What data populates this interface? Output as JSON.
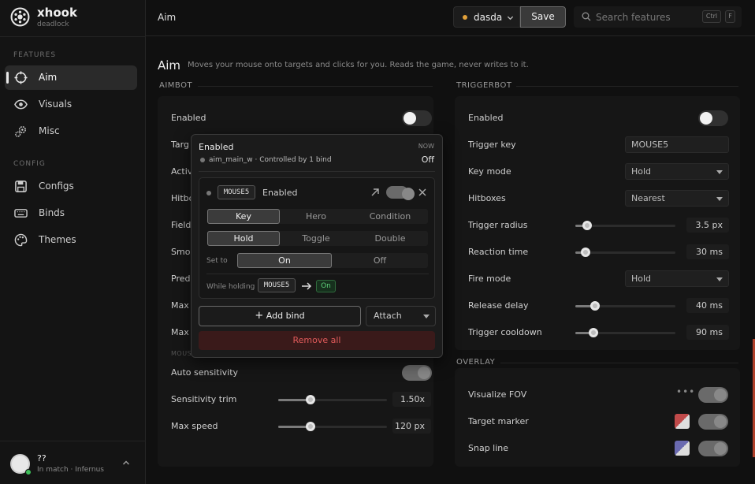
{
  "brand": {
    "name": "xhook",
    "subtitle": "deadlock"
  },
  "sidebar": {
    "features_label": "FEATURES",
    "config_label": "CONFIG",
    "items": [
      {
        "label": "Aim",
        "icon": "crosshair-icon",
        "active": true
      },
      {
        "label": "Visuals",
        "icon": "eye-icon"
      },
      {
        "label": "Misc",
        "icon": "gears-icon"
      },
      {
        "label": "Configs",
        "icon": "save-icon"
      },
      {
        "label": "Binds",
        "icon": "keyboard-icon"
      },
      {
        "label": "Themes",
        "icon": "palette-icon"
      }
    ]
  },
  "user": {
    "name": "??",
    "status": "In match · Infernus"
  },
  "topbar": {
    "breadcrumb": "Aim",
    "profile": "dasda",
    "save": "Save",
    "search_placeholder": "Search features",
    "kbd_ctrl": "Ctrl",
    "kbd_f": "F"
  },
  "page": {
    "title": "Aim",
    "description": "Moves your mouse onto targets and clicks for you. Reads the game, never writes to it."
  },
  "aimbot": {
    "header": "AIMBOT",
    "enabled_label": "Enabled",
    "hidden_labels": [
      "Targ",
      "Activ",
      "Hitbo",
      "Field",
      "Smo",
      "Pred",
      "Max",
      "Max"
    ],
    "mouse_header": "MOUS",
    "auto_sensitivity": "Auto sensitivity",
    "sensitivity_trim": {
      "label": "Sensitivity trim",
      "value": "1.50x",
      "fraction": 0.3
    },
    "max_speed": {
      "label": "Max speed",
      "value": "120 px",
      "fraction": 0.3
    }
  },
  "triggerbot": {
    "header": "TRIGGERBOT",
    "enabled_label": "Enabled",
    "trigger_key": {
      "label": "Trigger key",
      "value": "MOUSE5"
    },
    "key_mode": {
      "label": "Key mode",
      "value": "Hold"
    },
    "hitboxes": {
      "label": "Hitboxes",
      "value": "Nearest"
    },
    "trigger_radius": {
      "label": "Trigger radius",
      "value": "3.5 px",
      "fraction": 0.12
    },
    "reaction_time": {
      "label": "Reaction time",
      "value": "30 ms",
      "fraction": 0.1
    },
    "fire_mode": {
      "label": "Fire mode",
      "value": "Hold"
    },
    "release_delay": {
      "label": "Release delay",
      "value": "40 ms",
      "fraction": 0.2
    },
    "trigger_cooldown": {
      "label": "Trigger cooldown",
      "value": "90 ms",
      "fraction": 0.18
    }
  },
  "overlay": {
    "header": "OVERLAY",
    "visualize_fov": "Visualize FOV",
    "target_marker": "Target marker",
    "snap_line": "Snap line",
    "marker_color": "#c04a4a",
    "snap_color": "#6a6ab0"
  },
  "popover": {
    "title": "Enabled",
    "now_label": "NOW",
    "state": "Off",
    "var_name": "aim_main_w",
    "sep": "·",
    "controlled": "Controlled by 1 bind",
    "bind": {
      "key": "MOUSE5",
      "label": "Enabled",
      "source_tabs": [
        "Key",
        "Hero",
        "Condition"
      ],
      "mode_tabs": [
        "Hold",
        "Toggle",
        "Double"
      ],
      "set_to_label": "Set to",
      "set_to_options": [
        "On",
        "Off"
      ],
      "while_holding": "While holding",
      "result": "On"
    },
    "add_bind": "Add bind",
    "attach": "Attach",
    "remove_all": "Remove all"
  }
}
